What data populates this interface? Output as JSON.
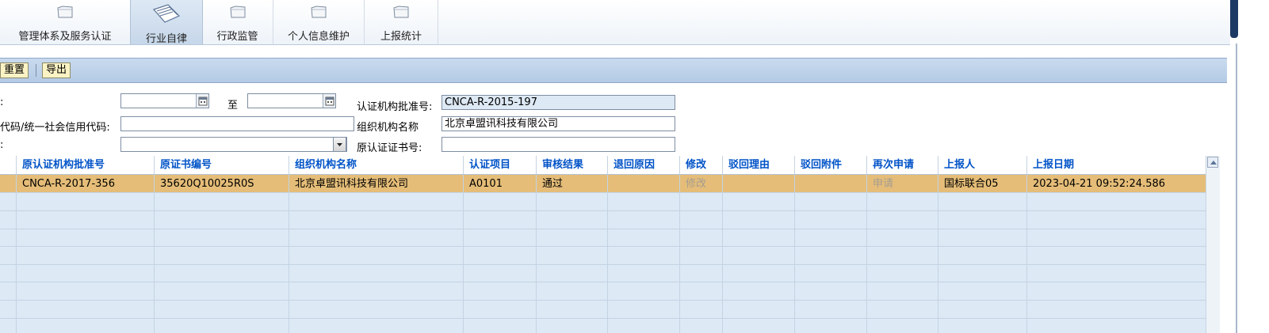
{
  "nav": {
    "tabs": [
      {
        "label": "管理体系及服务认证",
        "active": false
      },
      {
        "label": "行业自律",
        "active": true
      },
      {
        "label": "行政监管",
        "active": false
      },
      {
        "label": "个人信息维护",
        "active": false
      },
      {
        "label": "上报统计",
        "active": false
      }
    ]
  },
  "toolbar": {
    "reset_label": "重置",
    "export_label": "导出"
  },
  "form": {
    "date_label_partial": ":",
    "date_to_label": "至",
    "date_from_value": "",
    "date_to_value": "",
    "org_code_label": "代码/统一社会信用代码:",
    "org_code_value": "",
    "select_label_partial": ":",
    "select_value": "",
    "cert_body_no_label": "认证机构批准号:",
    "cert_body_no_value": "CNCA-R-2015-197",
    "org_name_label": "组织机构名称",
    "org_name_value": "北京卓盟讯科技有限公司",
    "orig_cert_no_label": "原认证证书号:",
    "orig_cert_no_value": ""
  },
  "table": {
    "columns": [
      "原认证机构批准号",
      "原证书编号",
      "组织机构名称",
      "认证项目",
      "审核结果",
      "退回原因",
      "修改",
      "驳回理由",
      "驳回附件",
      "再次申请",
      "上报人",
      "上报日期"
    ],
    "rows": [
      {
        "selected": true,
        "cells": [
          "CNCA-R-2017-356",
          "35620Q10025R0S",
          "北京卓盟讯科技有限公司",
          "A0101",
          "通过",
          "",
          "修改",
          "",
          "",
          "申请",
          "国标联合05",
          "2023-04-21 09:52:24.586"
        ]
      }
    ],
    "empty_rows": 8
  },
  "colors": {
    "header_text": "#0053c8",
    "selected_row": "#e5bd78",
    "grid_bg": "#dde9f4",
    "toolbar_bg": "#b4cbe5"
  }
}
